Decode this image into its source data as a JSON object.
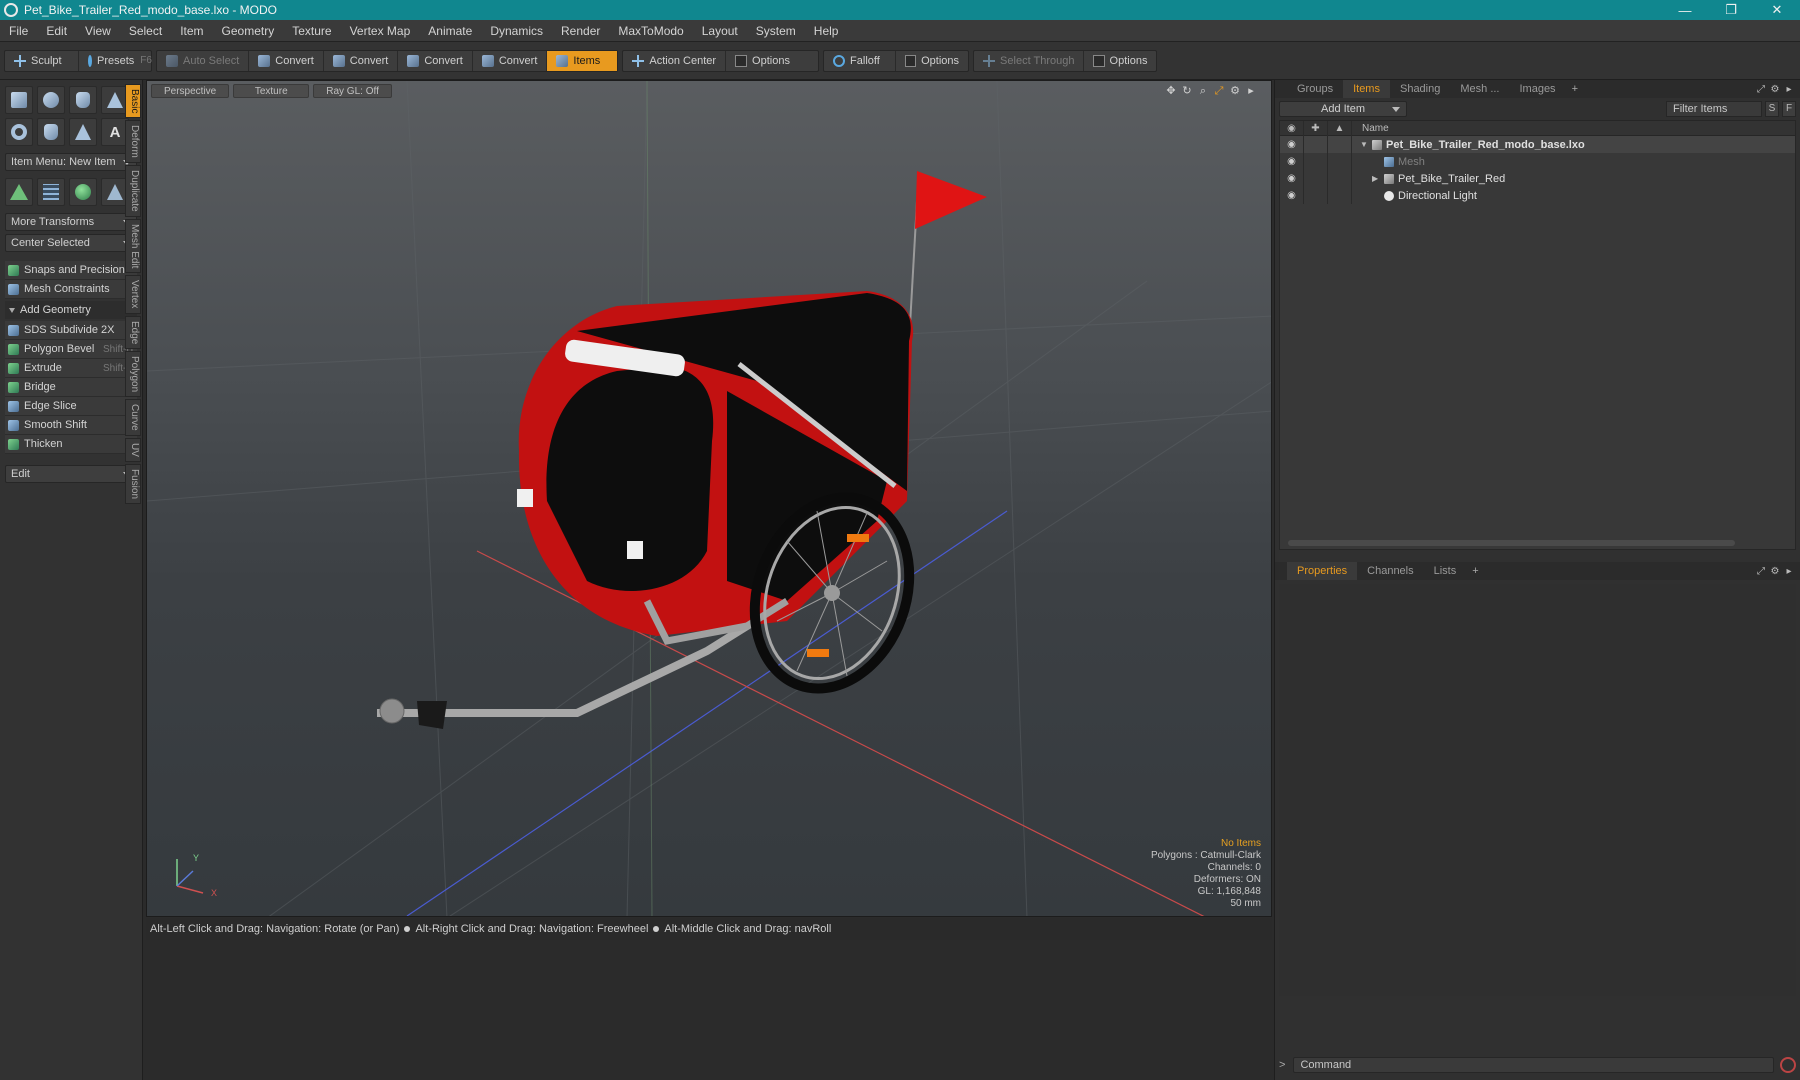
{
  "window": {
    "title": "Pet_Bike_Trailer_Red_modo_base.lxo - MODO",
    "minimize": "—",
    "restore": "❐",
    "close": "✕"
  },
  "menubar": [
    "File",
    "Edit",
    "View",
    "Select",
    "Item",
    "Geometry",
    "Texture",
    "Vertex Map",
    "Animate",
    "Dynamics",
    "Render",
    "MaxToModo",
    "Layout",
    "System",
    "Help"
  ],
  "toolbar": {
    "sculpt": "Sculpt",
    "presets": "Presets",
    "presets_key": "F6",
    "auto_select": "Auto Select",
    "convert1": "Convert",
    "convert2": "Convert",
    "convert3": "Convert",
    "convert4": "Convert",
    "items": "Items",
    "action_center": "Action Center",
    "options1": "Options",
    "falloff": "Falloff",
    "options2": "Options",
    "select_through": "Select Through",
    "options3": "Options"
  },
  "leftpanel": {
    "item_menu": "Item Menu: New Item",
    "more_transforms": "More Transforms",
    "center_selected": "Center Selected",
    "snaps": "Snaps and Precision",
    "mesh_constraints": "Mesh Constraints",
    "add_geometry": "Add Geometry",
    "tools": [
      {
        "label": "SDS Subdivide 2X",
        "shortcut": ""
      },
      {
        "label": "Polygon Bevel",
        "shortcut": "Shift-B"
      },
      {
        "label": "Extrude",
        "shortcut": "Shift-X"
      },
      {
        "label": "Bridge",
        "shortcut": ""
      },
      {
        "label": "Edge Slice",
        "shortcut": ""
      },
      {
        "label": "Smooth Shift",
        "shortcut": ""
      },
      {
        "label": "Thicken",
        "shortcut": ""
      }
    ],
    "edit": "Edit"
  },
  "vtabs": [
    "Basic",
    "Deform",
    "Duplicate",
    "Mesh Edit",
    "Vertex",
    "Edge",
    "Polygon",
    "Curve",
    "UV",
    "Fusion"
  ],
  "viewport": {
    "tabs": [
      "Perspective",
      "Texture",
      "Ray GL: Off"
    ],
    "info": {
      "no_items": "No Items",
      "polygons": "Polygons : Catmull-Clark",
      "channels": "Channels: 0",
      "deformers": "Deformers: ON",
      "gl": "GL: 1,168,848",
      "mm": "50 mm"
    },
    "axis_y": "Y",
    "axis_x": "X"
  },
  "statusbar": {
    "hint1": "Alt-Left Click and Drag: Navigation: Rotate (or Pan)",
    "hint2": "Alt-Right Click and Drag: Navigation: Freewheel",
    "hint3": "Alt-Middle Click and Drag: navRoll"
  },
  "rightpanel": {
    "tabs": [
      "Groups",
      "Items",
      "Shading",
      "Mesh ...",
      "Images"
    ],
    "add_item": "Add Item",
    "filter_items": "Filter Items",
    "s_btn": "S",
    "f_btn": "F",
    "col_name": "Name",
    "tree": [
      {
        "label": "Pet_Bike_Trailer_Red_modo_base.lxo"
      },
      {
        "label": "Mesh"
      },
      {
        "label": "Pet_Bike_Trailer_Red"
      },
      {
        "label": "Directional Light"
      }
    ],
    "props_tabs": [
      "Properties",
      "Channels",
      "Lists"
    ],
    "command_placeholder": "Command"
  },
  "colors": {
    "accent": "#e89a1f",
    "titlebar": "#10878f",
    "trailer_red": "#d01010"
  }
}
